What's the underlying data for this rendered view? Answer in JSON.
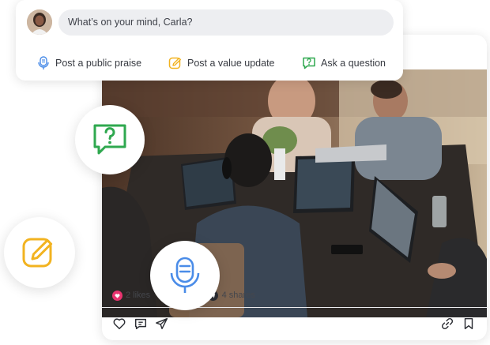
{
  "composer": {
    "placeholder": "What’s on your mind, Carla?",
    "actions": [
      {
        "label": "Post a public praise",
        "icon": "microphone-icon",
        "color": "#4a8ce8"
      },
      {
        "label": "Post a value update",
        "icon": "edit-icon",
        "color": "#f2b320"
      },
      {
        "label": "Ask a question",
        "icon": "question-chat-icon",
        "color": "#2fa84f"
      }
    ]
  },
  "post": {
    "likes": "2 likes",
    "comments_partial": ".c",
    "shares": "4 shares",
    "separator": "•",
    "like_color": "#e8336f"
  },
  "colors": {
    "praise": "#4a8ce8",
    "value": "#f2b320",
    "question": "#2fa84f"
  }
}
